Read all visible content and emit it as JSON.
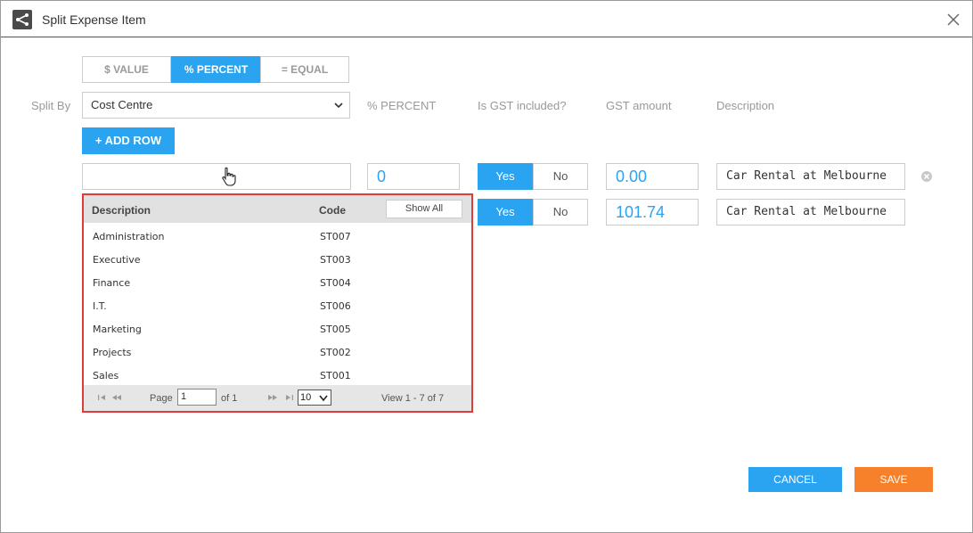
{
  "window": {
    "title": "Split Expense Item"
  },
  "split_mode": {
    "tabs": [
      {
        "label": "$ VALUE",
        "active": false
      },
      {
        "label": "% PERCENT",
        "active": true
      },
      {
        "label": "= EQUAL",
        "active": false
      }
    ]
  },
  "form": {
    "split_by_label": "Split By",
    "split_by_value": "Cost Centre",
    "col_percent": "% PERCENT",
    "col_gst_included": "Is GST included?",
    "col_gst_amount": "GST amount",
    "col_description": "Description",
    "add_row_label": "+ ADD ROW"
  },
  "rows": [
    {
      "cost_centre": "",
      "percent": "0",
      "gst_yes": "Yes",
      "gst_no": "No",
      "gst_selected": "Yes",
      "gst_amount": "0.00",
      "description": "Car Rental at Melbourne"
    },
    {
      "percent": "",
      "gst_yes": "Yes",
      "gst_no": "No",
      "gst_selected": "Yes",
      "gst_amount": "101.74",
      "description": "Car Rental at Melbourne"
    }
  ],
  "dropdown": {
    "header_description": "Description",
    "header_code": "Code",
    "show_all_label": "Show All",
    "items": [
      {
        "description": "Administration",
        "code": "ST007"
      },
      {
        "description": "Executive",
        "code": "ST003"
      },
      {
        "description": "Finance",
        "code": "ST004"
      },
      {
        "description": "I.T.",
        "code": "ST006"
      },
      {
        "description": "Marketing",
        "code": "ST005"
      },
      {
        "description": "Projects",
        "code": "ST002"
      },
      {
        "description": "Sales",
        "code": "ST001"
      }
    ],
    "pager": {
      "page_label": "Page",
      "page_value": "1",
      "of_label": "of 1",
      "page_size": "10",
      "view_text": "View 1 - 7 of 7"
    }
  },
  "footer": {
    "cancel_label": "CANCEL",
    "save_label": "SAVE"
  },
  "colors": {
    "accent": "#2aa3f0",
    "save": "#f7812a",
    "dropdown_border": "#e03a3a"
  },
  "icons": [
    "share-icon",
    "close-icon",
    "chevron-down-icon",
    "remove-row-icon",
    "first-page-icon",
    "prev-page-icon",
    "next-page-icon",
    "last-page-icon",
    "hand-cursor-icon"
  ]
}
